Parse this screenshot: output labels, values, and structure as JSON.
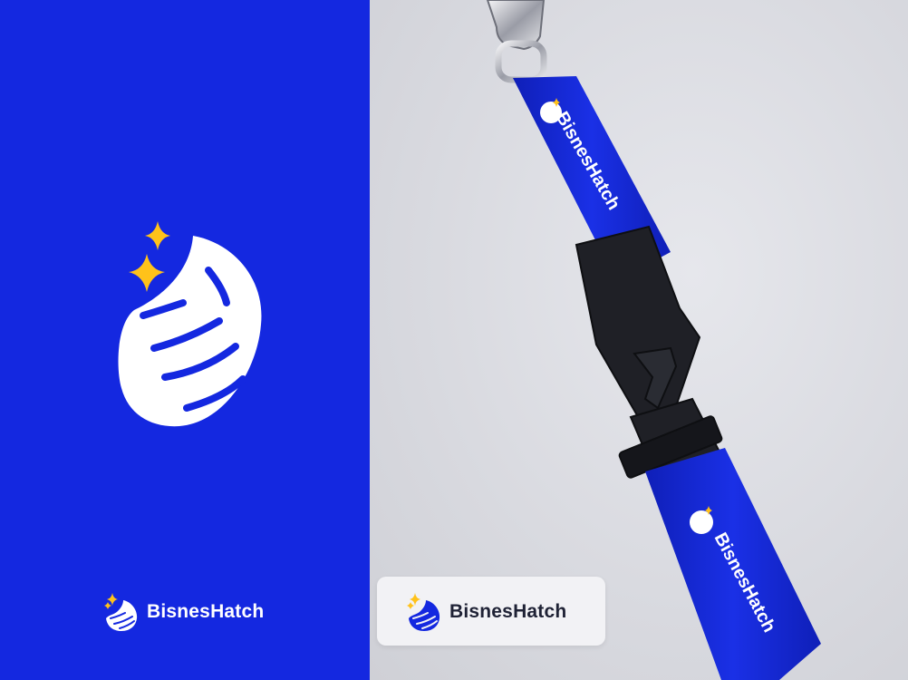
{
  "brand": {
    "name": "BisnesHatch",
    "colors": {
      "primary_blue": "#1428e0",
      "star_yellow": "#ffc21a",
      "white": "#ffffff",
      "dark_text": "#1f2235",
      "background_gray": "#d9dae0"
    }
  },
  "left_panel": {
    "logo_icon": "globe-with-stars-icon",
    "lockup_text": "BisnesHatch"
  },
  "right_panel": {
    "card_lockup_text": "BisnesHatch",
    "lanyard_text_top": "BisnesHatch",
    "lanyard_text_bottom": "BisnesHatch"
  }
}
